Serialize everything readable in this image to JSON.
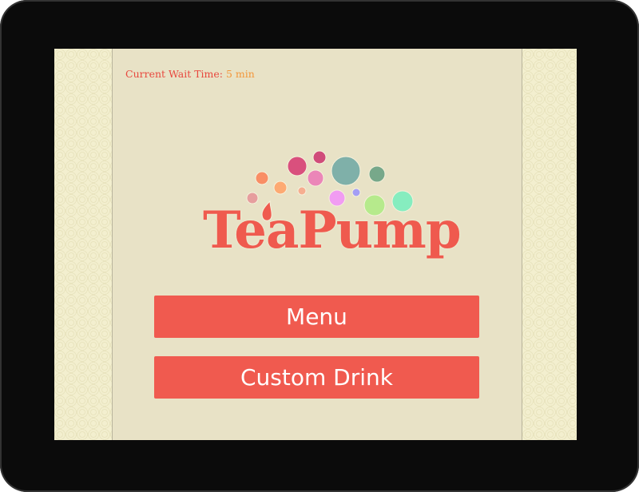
{
  "header": {
    "wait_label": "Current Wait Time:",
    "wait_value": "5 min"
  },
  "logo": {
    "brand": "TeaPump",
    "colors": {
      "brand": "#ef5a4e"
    }
  },
  "buttons": {
    "menu": "Menu",
    "custom": "Custom Drink"
  },
  "colors": {
    "button": "#f05a4f",
    "background": "#e8e2c6",
    "wait_value": "#f3963a"
  }
}
